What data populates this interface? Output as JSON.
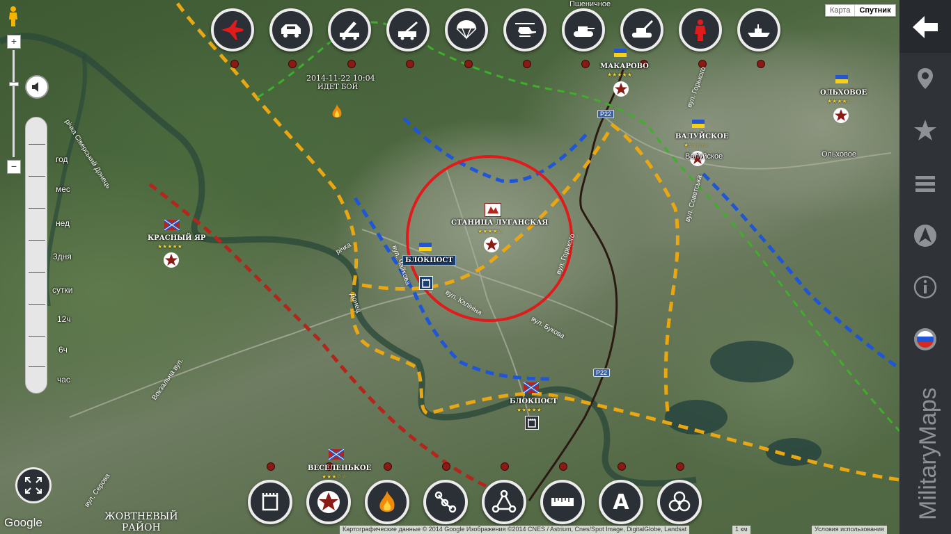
{
  "map_type": {
    "map": "Карта",
    "satellite": "Спутник"
  },
  "weapon_filters": [
    {
      "name": "aircraft",
      "icon": "jet-icon"
    },
    {
      "name": "armored-car",
      "icon": "armored-car-icon"
    },
    {
      "name": "mlrs",
      "icon": "mlrs-icon"
    },
    {
      "name": "artillery",
      "icon": "artillery-icon"
    },
    {
      "name": "paratroopers",
      "icon": "parachute-icon"
    },
    {
      "name": "helicopter",
      "icon": "helicopter-icon"
    },
    {
      "name": "tank",
      "icon": "tank-icon"
    },
    {
      "name": "self-propelled-artillery",
      "icon": "spg-icon"
    },
    {
      "name": "soldier",
      "icon": "soldier-icon"
    },
    {
      "name": "navy",
      "icon": "warship-icon"
    }
  ],
  "time_slider": {
    "labels": [
      "год",
      "мес",
      "нед",
      "3дня",
      "сутки",
      "12ч",
      "6ч",
      "час"
    ]
  },
  "event": {
    "timestamp": "2014-11-22 10:04",
    "status": "ИДЕТ БОЙ"
  },
  "places": {
    "makarovo": "МАКАРОВО",
    "olkhovoe": "ОЛЬХОВОЕ",
    "valuyskoe": "ВАЛУЙСКОЕ",
    "stanitsa": "СТАНИЦА ЛУГАНСКАЯ",
    "krasny_yar": "КРАСНЫЙ ЯР",
    "checkpoint1": "БЛОКПОСТ",
    "checkpoint2": "БЛОКПОСТ",
    "veselenkoe": "ВЕСЕЛЕНЬКОЕ",
    "pshenichnoe": "Пшеничное",
    "olkhovoe_map": "Ольховое",
    "valuyskoe_map": "Валуйское",
    "district_line1": "ЖОВТНЕВЫЙ",
    "district_line2": "РАЙОН"
  },
  "stars": {
    "five": "★★★★★",
    "four": "★★★★☆",
    "three": "★★★☆☆",
    "one": "★☆☆☆☆"
  },
  "roads": {
    "r22": "P22"
  },
  "streets": {
    "seversky": "річка Сіверський Донець",
    "rechka": "річка",
    "donets": "Донец",
    "chaikova": "вул. Чайкова",
    "kalinina": "вул. Калініна",
    "bukova": "вул. Букова",
    "gorkogo": "вул. Горького",
    "gorkogo2": "вул. Горького",
    "sovetska": "вул. Советська",
    "vokzalna": "Вокзальна вул.",
    "serova": "вул. Серова"
  },
  "tools": [
    {
      "name": "checkpoint",
      "icon": "checkpoint-icon"
    },
    {
      "name": "star",
      "icon": "star-icon"
    },
    {
      "name": "fire",
      "icon": "fire-icon"
    },
    {
      "name": "route",
      "icon": "route-icon"
    },
    {
      "name": "triangle",
      "icon": "triangle-route-icon"
    },
    {
      "name": "ruler",
      "icon": "ruler-icon"
    },
    {
      "name": "text",
      "icon": "text-icon",
      "letter": "A"
    },
    {
      "name": "biohazard",
      "icon": "biohazard-icon"
    }
  ],
  "sidebar": {
    "brand": "MilitaryMaps"
  },
  "footer": {
    "google": "Google",
    "attribution": "Картографические данные © 2014 Google Изображения ©2014 CNES / Astrium, Cnes/Spot Image, DigitalGlobe, Landsat",
    "scale": "1 км",
    "terms": "Условия использования"
  },
  "colors": {
    "ua": "#1f56d6",
    "rebel": "#b3261c",
    "yellow_line": "#e8a713",
    "green_line": "#3fae2b",
    "focus_circle": "#e01b1b"
  }
}
